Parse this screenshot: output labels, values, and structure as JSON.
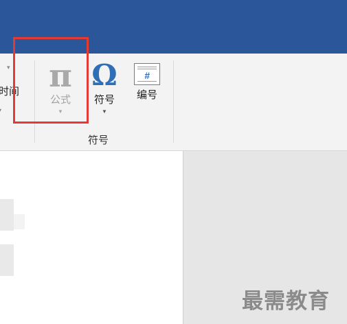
{
  "ribbon": {
    "time_label": "时间",
    "formula_label": "公式",
    "symbol_label": "符号",
    "number_label": "编号",
    "group_label": "符号",
    "icons": {
      "formula": "π",
      "symbol": "Ω",
      "number": "#"
    }
  },
  "colors": {
    "titlebar": "#2b579a",
    "highlight": "#e53935",
    "omega": "#2e6fb7"
  },
  "watermark": "最需教育"
}
